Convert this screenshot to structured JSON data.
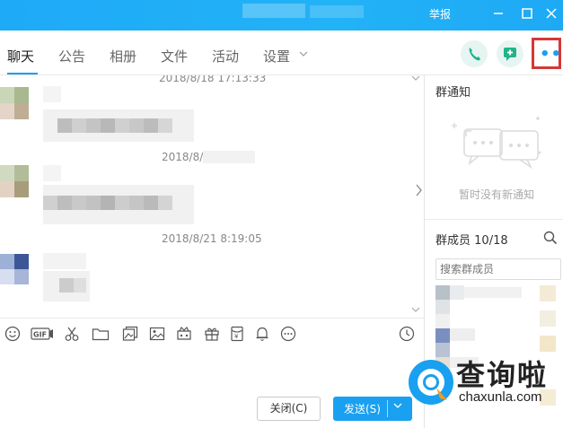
{
  "window": {
    "report_label": "举报",
    "minimize_icon": "minimize-icon",
    "maximize_icon": "maximize-icon",
    "close_icon": "close-icon"
  },
  "tabs": [
    {
      "label": "聊天",
      "active": true
    },
    {
      "label": "公告"
    },
    {
      "label": "相册"
    },
    {
      "label": "文件"
    },
    {
      "label": "活动"
    },
    {
      "label": "设置"
    }
  ],
  "header_actions": {
    "call_icon": "phone-icon",
    "invite_icon": "add-chat-icon",
    "more_icon": "more-icon"
  },
  "chat": {
    "timestamps": [
      "2018/8/18 17:13:33",
      "2018/8/",
      "2018/8/21 8:19:05"
    ]
  },
  "toolbar_icons": [
    "emoji-icon",
    "gif-icon",
    "scissors-icon",
    "folder-icon",
    "image-collection-icon",
    "image-icon",
    "gift-box-icon",
    "gift-icon",
    "red-packet-icon",
    "bell-icon",
    "more-circle-icon",
    "history-icon"
  ],
  "actions": {
    "close_label": "关闭(C)",
    "send_label": "发送(S)"
  },
  "panel": {
    "notice_title": "群通知",
    "empty_notice": "暂时没有新通知",
    "members_title": "群成员",
    "members_count": "10/18",
    "search_placeholder": "搜索群成员"
  },
  "watermark": {
    "brand": "查询啦",
    "domain": "chaxunla.com"
  },
  "colors": {
    "titlebar": "#1faaf8",
    "accent": "#1aa0f0",
    "highlight_box": "#d53737"
  }
}
